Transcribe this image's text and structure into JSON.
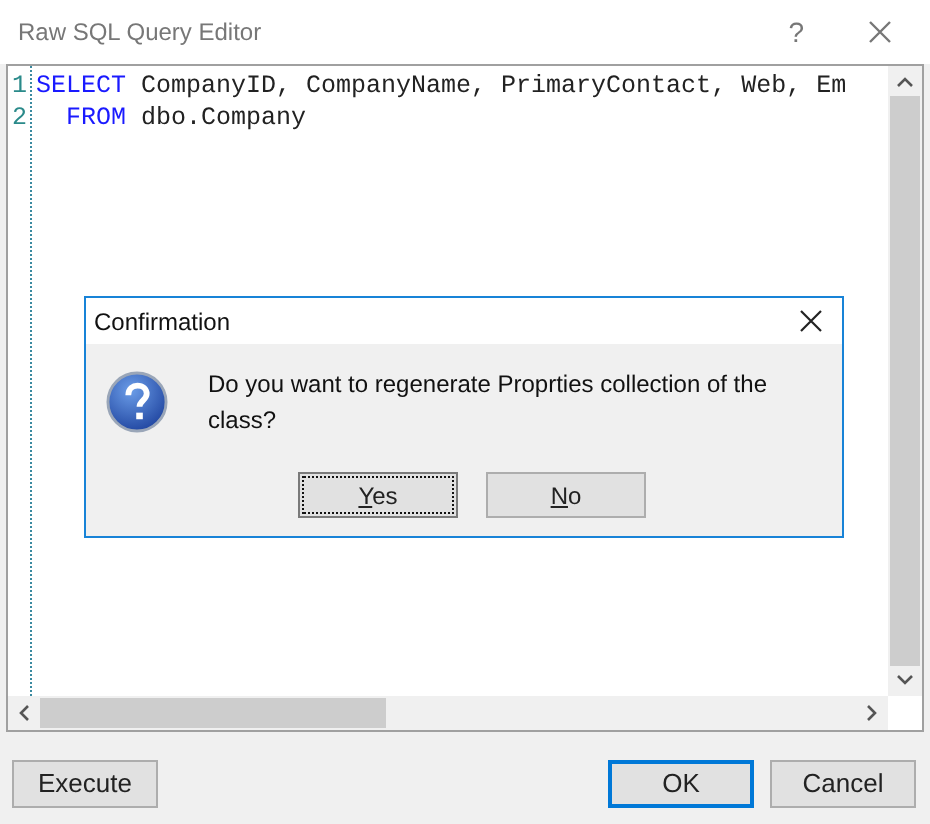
{
  "window": {
    "title": "Raw SQL Query Editor",
    "help": "?"
  },
  "editor": {
    "lines": [
      {
        "number": "1",
        "tokens": [
          {
            "text": "SELECT",
            "kind": "keyword"
          },
          {
            "text": " CompanyID, CompanyName, PrimaryContact, Web, Em",
            "kind": "plain"
          }
        ]
      },
      {
        "number": "2",
        "tokens": [
          {
            "text": "  FROM",
            "kind": "keyword"
          },
          {
            "text": " dbo.Company",
            "kind": "plain"
          }
        ]
      }
    ]
  },
  "dialog": {
    "title": "Confirmation",
    "message": "Do you want to regenerate Proprties collection of the class?",
    "buttons": [
      {
        "label": "Yes",
        "focused": true
      },
      {
        "label": "No",
        "focused": false
      }
    ]
  },
  "footer": {
    "left_buttons": [
      {
        "label": "Execute",
        "default": false
      }
    ],
    "right_buttons": [
      {
        "label": "OK",
        "default": true
      },
      {
        "label": "Cancel",
        "default": false
      }
    ]
  }
}
